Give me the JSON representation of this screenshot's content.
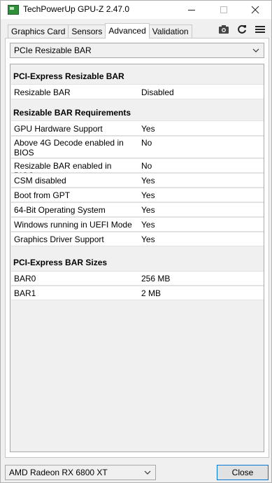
{
  "window": {
    "title": "TechPowerUp GPU-Z 2.47.0"
  },
  "tabs": [
    {
      "label": "Graphics Card",
      "active": false
    },
    {
      "label": "Sensors",
      "active": false
    },
    {
      "label": "Advanced",
      "active": true
    },
    {
      "label": "Validation",
      "active": false
    }
  ],
  "toolbar": {
    "icons": [
      "camera-icon",
      "refresh-icon",
      "menu-icon"
    ]
  },
  "panel": {
    "selected_section": "PCIe Resizable BAR",
    "sections": [
      {
        "heading": "PCI-Express Resizable BAR",
        "rows": [
          {
            "label": "Resizable BAR",
            "value": "Disabled"
          }
        ]
      },
      {
        "heading": "Resizable BAR Requirements",
        "rows": [
          {
            "label": "GPU Hardware Support",
            "value": "Yes"
          },
          {
            "label": "Above 4G Decode enabled in BIOS",
            "value": "No"
          },
          {
            "label": "Resizable BAR enabled in BIOS",
            "value": "No"
          },
          {
            "label": "CSM disabled",
            "value": "Yes"
          },
          {
            "label": "Boot from GPT",
            "value": "Yes"
          },
          {
            "label": "64-Bit Operating System",
            "value": "Yes"
          },
          {
            "label": "Windows running in UEFI Mode",
            "value": "Yes"
          },
          {
            "label": "Graphics Driver Support",
            "value": "Yes"
          }
        ]
      },
      {
        "heading": "PCI-Express BAR Sizes",
        "rows": [
          {
            "label": "BAR0",
            "value": "256 MB"
          },
          {
            "label": "BAR1",
            "value": "2 MB"
          }
        ]
      }
    ]
  },
  "footer": {
    "gpu_selected": "AMD Radeon RX 6800 XT",
    "close_label": "Close"
  },
  "colors": {
    "window_bg": "#f0f0f0",
    "panel_bg": "#ffffff",
    "accent_border": "#0078d7"
  }
}
